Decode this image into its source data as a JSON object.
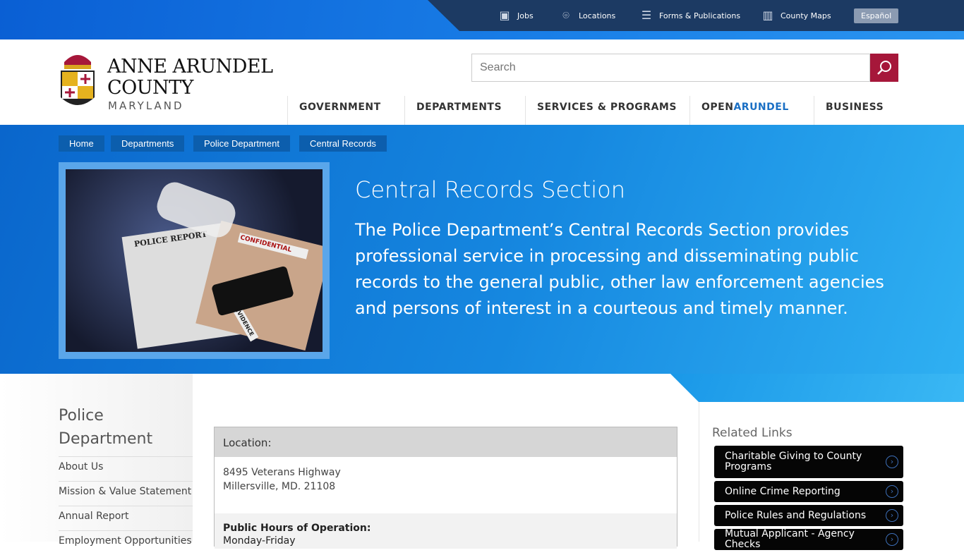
{
  "utility": {
    "items": [
      {
        "label": "Jobs",
        "icon": "briefcase-icon"
      },
      {
        "label": "Locations",
        "icon": "map-pin-icon"
      },
      {
        "label": "Forms & Publications",
        "icon": "document-icon"
      },
      {
        "label": "County Maps",
        "icon": "map-icon"
      }
    ],
    "espanol": "Español"
  },
  "logo": {
    "line1": "ANNE ARUNDEL",
    "line2": "COUNTY",
    "line3": "MARYLAND"
  },
  "search": {
    "placeholder": "Search"
  },
  "nav": [
    {
      "label": "GOVERNMENT"
    },
    {
      "label": "DEPARTMENTS"
    },
    {
      "label": "SERVICES & PROGRAMS"
    },
    {
      "label_a": "OPEN",
      "label_b": "ARUNDEL"
    },
    {
      "label": "BUSINESS"
    }
  ],
  "breadcrumb": [
    "Home",
    "Departments",
    "Police Department",
    "Central Records"
  ],
  "hero": {
    "title": "Central Records Section",
    "description": "The Police Department’s Central Records Section provides professional service in processing and disseminating public records to the general public, other law enforcement agencies and persons of interest in a courteous and timely manner.",
    "photo_labels": {
      "report": "POLICE REPORT",
      "confidential": "CONFIDENTIAL",
      "evidence": "EVIDENCE"
    }
  },
  "sidebar": {
    "title": "Police Department",
    "items": [
      "About Us",
      "Mission & Value Statement",
      "Annual Report",
      "Employment Opportunities"
    ]
  },
  "card": {
    "location_label": "Location:",
    "address1": "8495 Veterans Highway",
    "address2": "Millersville, MD. 21108",
    "hours_label": "Public Hours of Operation:",
    "hours_days": "Monday-Friday"
  },
  "related": {
    "title": "Related Links",
    "items": [
      "Charitable Giving to County Programs",
      "Online Crime Reporting",
      "Police Rules and Regulations",
      "Mutual Applicant - Agency Checks"
    ]
  },
  "colors": {
    "accent": "#a6173a",
    "utility_bar": "#1c3a63",
    "crumb": "#0c5ead"
  }
}
